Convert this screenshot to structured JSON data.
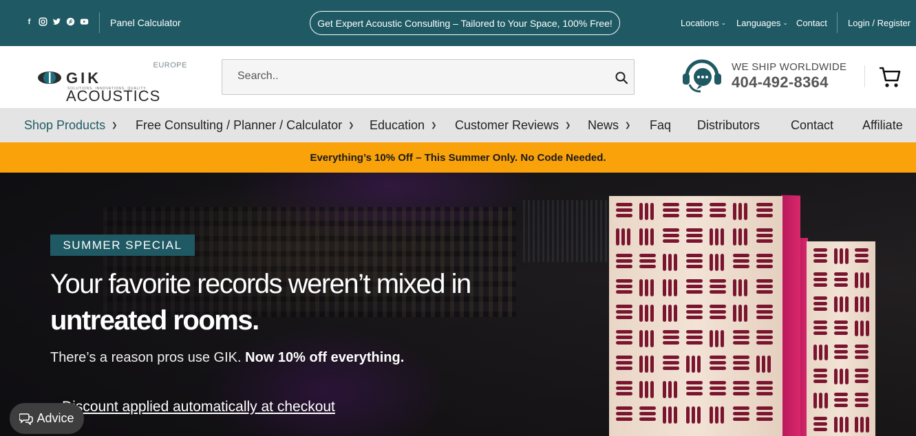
{
  "topbar": {
    "social_icons": [
      "facebook-icon",
      "instagram-icon",
      "twitter-icon",
      "pinterest-icon",
      "youtube-icon"
    ],
    "panel_calculator": "Panel Calculator",
    "consulting_pill": "Get Expert Acoustic Consulting – Tailored to Your Space, 100% Free!",
    "locations": "Locations",
    "languages": "Languages",
    "contact": "Contact",
    "login_register": "Login / Register"
  },
  "header": {
    "logo": {
      "region": "EUROPE",
      "brand_bold": "GIK",
      "brand": "ACOUSTICS",
      "tagline": "SOLUTIONS. INNOVATIONS. QUALITY."
    },
    "search_placeholder": "Search..",
    "ship_label": "WE SHIP WORLDWIDE",
    "phone": "404-492-8364"
  },
  "nav": {
    "items": [
      {
        "label": "Shop Products",
        "dropdown": true
      },
      {
        "label": "Free Consulting / Planner / Calculator",
        "dropdown": true
      },
      {
        "label": "Education",
        "dropdown": true
      },
      {
        "label": "Customer Reviews",
        "dropdown": true
      },
      {
        "label": "News",
        "dropdown": true
      },
      {
        "label": "Faq",
        "dropdown": false
      },
      {
        "label": "Distributors",
        "dropdown": false
      },
      {
        "label": "Contact",
        "dropdown": false
      },
      {
        "label": "Affiliate",
        "dropdown": false
      }
    ]
  },
  "promo": {
    "text": "Everything’s 10% Off – This Summer Only. No Code Needed."
  },
  "hero": {
    "badge": "SUMMER SPECIAL",
    "headline_line1": "Your favorite records weren’t mixed in",
    "headline_line2": "untreated rooms.",
    "sub_regular": "There’s a reason pros use GIK.",
    "sub_bold": "Now 10% off everything.",
    "link": "Discount applied automatically at checkout"
  },
  "advice_button": "Advice",
  "colors": {
    "teal": "#1f5a64",
    "promo": "#f9a20a",
    "panel_edge": "#c81f63",
    "slot": "#7a1530"
  }
}
